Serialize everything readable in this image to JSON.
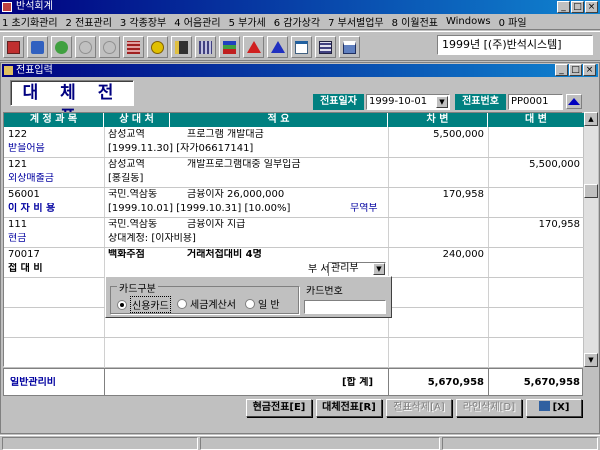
{
  "app": {
    "title": "반석회계"
  },
  "window_buttons": [
    "_",
    "□",
    "×"
  ],
  "menu": [
    "1 초기화관리",
    "2 전표관리",
    "3 각종장부",
    "4 어음관리",
    "5 부가세",
    "6 감가상각",
    "7 부서별업무",
    "8 이월전표",
    "Windows",
    "0 파일"
  ],
  "toolbar": {
    "icons": [
      "exit-icon",
      "network-icon",
      "globe-icon",
      "disabled-tool-1-icon",
      "disabled-tool-2-icon",
      "grid-icon",
      "coin-icon",
      "book-icon",
      "building-icon",
      "chart-icon",
      "arrow-up-red-icon",
      "arrow-up-blue-icon",
      "document-icon",
      "calculator-icon",
      "printer-icon"
    ],
    "company": "1999년 [(주)반석시스템]"
  },
  "child_window": {
    "title": "전표입력",
    "buttons": [
      "_",
      "□",
      "×"
    ]
  },
  "voucher": {
    "heading": "대 체 전 표",
    "date_label": "전표일자",
    "date_value": "1999-10-01",
    "number_label": "전표번호",
    "number_value": "PP0001"
  },
  "grid": {
    "headers": [
      "계 정 과 목",
      "상 대 처",
      "적                    요",
      "차   변",
      "대   변"
    ],
    "rows": [
      {
        "code": "122",
        "account": "받을어음",
        "party": "삼성교역",
        "desc1": "프로그램 개발대금",
        "desc2": "[1999.11.30] [자가06617141]",
        "extra": "",
        "debit": "5,500,000",
        "credit": ""
      },
      {
        "code": "121",
        "account": "외상매출금",
        "party": "삼성교역",
        "desc1": "개발프로그램대중 일부입금",
        "desc2": "[홍길동]",
        "extra": "",
        "debit": "",
        "credit": "5,500,000"
      },
      {
        "code": "56001",
        "account": "이 자 비 용",
        "party": "국민.역삼동",
        "desc1": "금융이자 26,000,000",
        "desc2": "[1999.10.01] [1999.10.31] [10.00%]",
        "extra": "무역부",
        "debit": "170,958",
        "credit": ""
      },
      {
        "code": "111",
        "account": "현금",
        "party": "국민.역삼동",
        "desc1": "금융이자 지급",
        "desc2": "상대계정: [이자비용]",
        "extra": "",
        "debit": "",
        "credit": "170,958"
      },
      {
        "code": "70017",
        "account": "접   대   비",
        "party": "백화주점",
        "desc1": "거래처접대비 4명",
        "desc2": "",
        "extra": "",
        "debit": "240,000",
        "credit": ""
      }
    ],
    "dept_label": "부 서",
    "dept_value": "관리부"
  },
  "card_panel": {
    "group_label": "카드구분",
    "options": [
      "신용카드",
      "세금계산서",
      "일   반"
    ],
    "selected": "신용카드",
    "card_no_label": "카드번호",
    "card_no_value": ""
  },
  "totals": {
    "category": "일반관리비",
    "label": "[합   계]",
    "debit": "5,670,958",
    "credit": "5,670,958"
  },
  "buttons": {
    "cash": "현금전표[E]",
    "transfer": "대체전표[R]",
    "delete_voucher": "전표삭제[A]",
    "delete_line": "라인삭제[D]",
    "close": "[X]"
  }
}
